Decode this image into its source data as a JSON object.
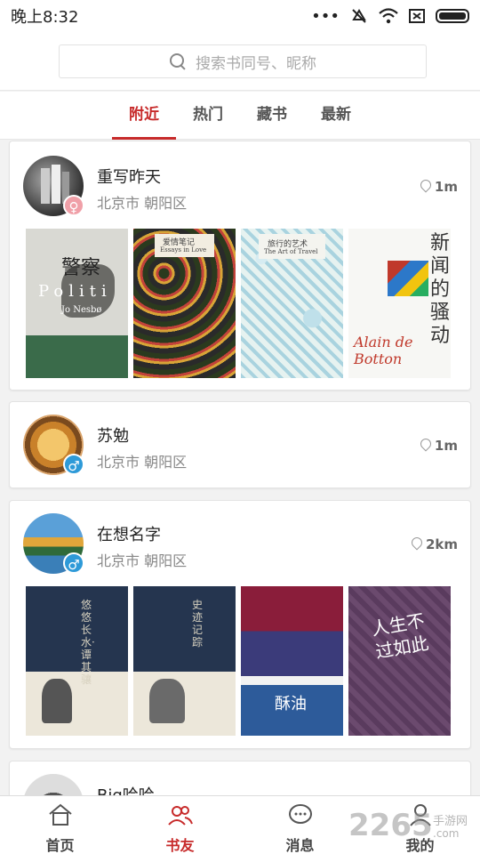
{
  "status_bar": {
    "time": "晚上8:32",
    "icons": [
      "more-dots-icon",
      "mute-icon",
      "wifi-icon",
      "sim-icon",
      "battery-icon"
    ]
  },
  "search": {
    "placeholder": "搜索书同号、昵称"
  },
  "tabs": [
    {
      "label": "附近",
      "active": true
    },
    {
      "label": "热门",
      "active": false
    },
    {
      "label": "藏书",
      "active": false
    },
    {
      "label": "最新",
      "active": false
    }
  ],
  "feed": [
    {
      "name": "重写昨天",
      "location": "北京市 朝阳区",
      "distance": "1m",
      "gender": "female",
      "books": [
        {
          "title": "警察",
          "subtitle": "Politi",
          "author": "Jo Nesbø"
        },
        {
          "title": "爱情笔记",
          "subtitle": "Essays in Love"
        },
        {
          "title": "旅行的艺术",
          "subtitle": "The Art of Travel"
        },
        {
          "title": "新闻的骚动",
          "author": "Alain de Botton"
        }
      ]
    },
    {
      "name": "苏勉",
      "location": "北京市 朝阳区",
      "distance": "1m",
      "gender": "male",
      "books": []
    },
    {
      "name": "在想名字",
      "location": "北京市 朝阳区",
      "distance": "2km",
      "gender": "male",
      "books": [
        {
          "title": "悠悠长水·谭其骧"
        },
        {
          "title": "史迹记踪"
        },
        {
          "title": "酥油"
        },
        {
          "title": "人生不过如此"
        }
      ]
    },
    {
      "name": "Big哈哈",
      "location": "",
      "distance": "",
      "gender": "",
      "books": []
    }
  ],
  "bottom_nav": [
    {
      "label": "首页",
      "icon": "home-icon",
      "active": false
    },
    {
      "label": "书友",
      "icon": "friends-icon",
      "active": true
    },
    {
      "label": "消息",
      "icon": "message-icon",
      "active": false
    },
    {
      "label": "我的",
      "icon": "profile-icon",
      "active": false
    }
  ],
  "watermark": {
    "text": "2265",
    "sub1": "手游网",
    "sub2": ".com"
  },
  "colors": {
    "accent": "#c72a2a",
    "male": "#2e9ad8",
    "female": "#f0a0a8"
  }
}
